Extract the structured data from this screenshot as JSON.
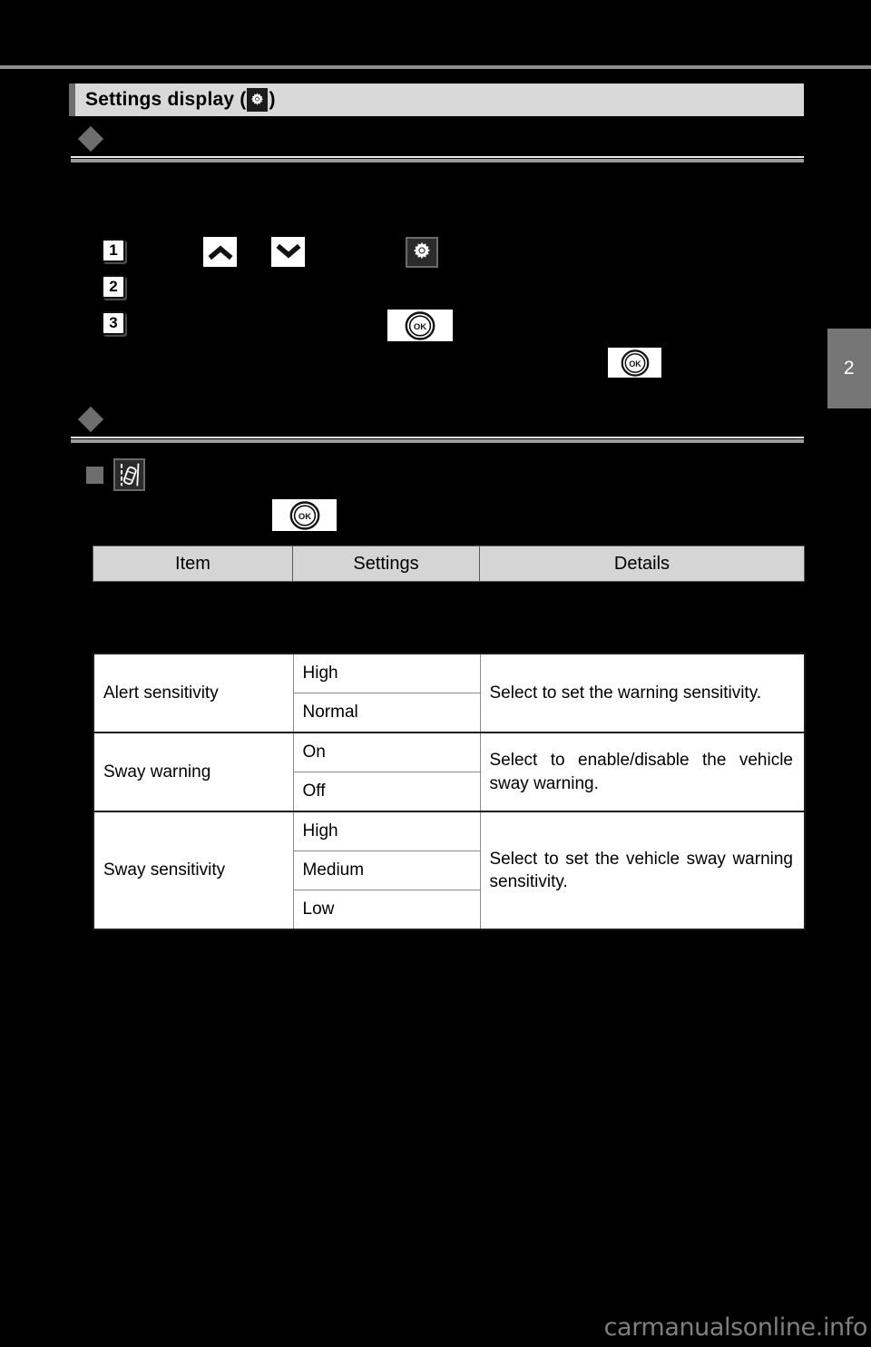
{
  "page": {
    "chapter_tab": "2",
    "watermark": "carmanualsonline.info"
  },
  "section": {
    "title_prefix": "Settings display (",
    "title_suffix": ")",
    "gear_icon": "gear-icon"
  },
  "steps": [
    {
      "number": "1"
    },
    {
      "number": "2"
    },
    {
      "number": "3"
    }
  ],
  "step_icons": {
    "up_arrow": "chevron-up-icon",
    "down_arrow": "chevron-down-icon",
    "gear": "gear-icon",
    "ok_button": "OK"
  },
  "subsection": {
    "bullet": "square-bullet",
    "lane_icon": "lane-departure-warning-icon",
    "ok_button": "OK"
  },
  "table": {
    "headers": [
      "Item",
      "Settings",
      "Details"
    ],
    "rows": [
      {
        "item": "Alert sensitivity",
        "settings": [
          "High",
          "Normal"
        ],
        "details": "Select to set the warning sensitivity."
      },
      {
        "item": "Sway warning",
        "settings": [
          "On",
          "Off"
        ],
        "details": "Select to enable/disable the vehicle sway warning."
      },
      {
        "item": "Sway sensitivity",
        "settings": [
          "High",
          "Medium",
          "Low"
        ],
        "details": "Select to set the vehicle sway warning sensitivity."
      }
    ]
  },
  "colors": {
    "page_background": "#000000",
    "section_bar": "#d9d9d9",
    "section_accent": "#6e6e6e",
    "bullet_gray": "#6e6e6e",
    "table_header": "#d5d5d5",
    "chapter_tab": "#767676",
    "watermark": "#7f7f7f"
  }
}
